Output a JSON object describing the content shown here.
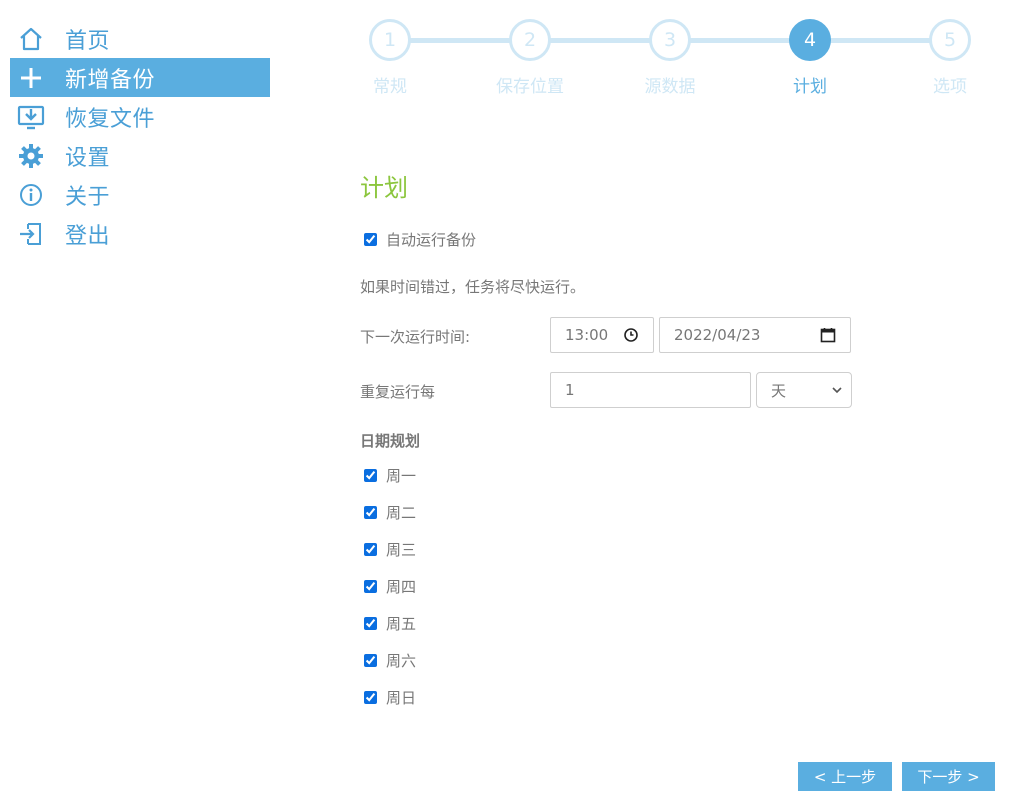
{
  "sidebar": {
    "items": [
      {
        "label": "首页",
        "icon": "home-icon"
      },
      {
        "label": "新增备份",
        "icon": "plus-icon",
        "active": true
      },
      {
        "label": "恢复文件",
        "icon": "restore-icon"
      },
      {
        "label": "设置",
        "icon": "gear-icon"
      },
      {
        "label": "关于",
        "icon": "info-icon"
      },
      {
        "label": "登出",
        "icon": "logout-icon"
      }
    ]
  },
  "stepper": {
    "steps": [
      {
        "number": "1",
        "label": "常规"
      },
      {
        "number": "2",
        "label": "保存位置"
      },
      {
        "number": "3",
        "label": "源数据"
      },
      {
        "number": "4",
        "label": "计划"
      },
      {
        "number": "5",
        "label": "选项"
      }
    ],
    "active_step": 4
  },
  "schedule": {
    "title": "计划",
    "auto_run_label": "自动运行备份",
    "auto_run_checked": true,
    "missed_note": "如果时间错过，任务将尽快运行。",
    "next_run_label": "下一次运行时间:",
    "next_run_time": "13:00",
    "next_run_date": "2022/04/23",
    "repeat_label": "重复运行每",
    "repeat_value": "1",
    "repeat_unit": "天",
    "days_heading": "日期规划",
    "days": [
      {
        "label": "周一",
        "checked": true
      },
      {
        "label": "周二",
        "checked": true
      },
      {
        "label": "周三",
        "checked": true
      },
      {
        "label": "周四",
        "checked": true
      },
      {
        "label": "周五",
        "checked": true
      },
      {
        "label": "周六",
        "checked": true
      },
      {
        "label": "周日",
        "checked": true
      }
    ]
  },
  "footer": {
    "prev_label": "< 上一步",
    "next_label": "下一步 >"
  },
  "colors": {
    "accent": "#5aaee0",
    "title_green": "#8cc63e",
    "step_inactive": "#cfe7f5"
  }
}
